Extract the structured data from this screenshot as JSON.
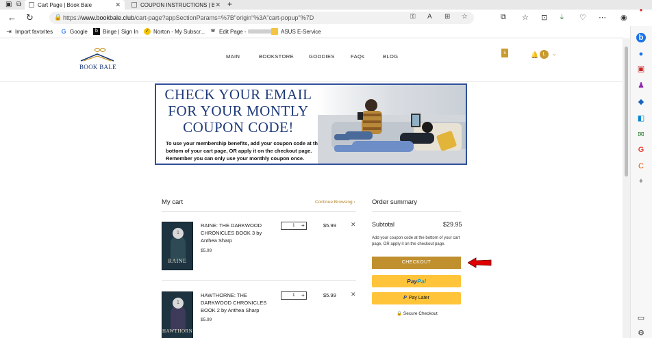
{
  "browser": {
    "tabs": [
      {
        "title": "Cart Page | Book Bale",
        "active": true
      },
      {
        "title": "COUPON INSTRUCTIONS | Book",
        "active": false
      }
    ],
    "url_prefix": "https://",
    "url_host": "www.bookbale.club",
    "url_path": "/cart-page?appSectionParams=%7B\"origin\"%3A\"cart-popup\"%7D",
    "bookmarks": [
      {
        "label": "Import favorites",
        "icon": "import-icon"
      },
      {
        "label": "Google",
        "icon": "google-icon"
      },
      {
        "label": "Binge | Sign In",
        "icon": "binge-icon"
      },
      {
        "label": "Norton - My Subscr...",
        "icon": "norton-icon"
      },
      {
        "label": "Edit Page -",
        "icon": "wix-icon"
      },
      {
        "label": "ASUS E-Service",
        "icon": "folder-icon"
      }
    ]
  },
  "site": {
    "logo_text": "BOOK BALE",
    "menu": [
      "MAIN",
      "BOOKSTORE",
      "GOODIES",
      "FAQs",
      "BLOG"
    ],
    "cart_count": "5",
    "user_initial": "L",
    "accent": "#c08f2e"
  },
  "banner": {
    "headline": "CHECK YOUR EMAIL FOR YOUR MONTLY COUPON CODE!",
    "body": "To use your membership benefits, add your coupon code at the bottom of your cart page, OR apply it on the checkout page. Remember you can only use your monthly coupon once."
  },
  "cart": {
    "title": "My cart",
    "continue_label": "Continue Browsing",
    "items": [
      {
        "title": "RAINE: THE DARKWOOD CHRONICLES BOOK 3 by Anthea Sharp",
        "unit_price": "$5.99",
        "qty": "1",
        "price": "$5.99",
        "cover_text": "RAINE"
      },
      {
        "title": "HAWTHORNE: THE DARKWOOD CHRONICLES BOOK 2 by Anthea Sharp",
        "unit_price": "$5.99",
        "qty": "1",
        "price": "$5.99",
        "cover_text": "HAWTHORNE"
      }
    ]
  },
  "summary": {
    "title": "Order summary",
    "subtotal_label": "Subtotal",
    "subtotal_value": "$29.95",
    "note": "Add your coupon code at the bottom of your cart page, OR apply it on the checkout page.",
    "checkout_label": "CHECKOUT",
    "paypal_a": "Pay",
    "paypal_b": "Pal",
    "paylater_label": "Pay Later",
    "secure_label": "Secure Checkout"
  }
}
